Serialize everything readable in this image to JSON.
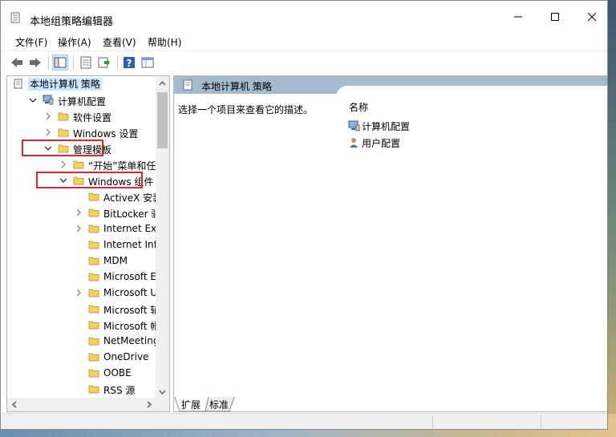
{
  "window": {
    "title": "本地组策略编辑器",
    "controls": [
      "minimize",
      "maximize",
      "close"
    ]
  },
  "menu": [
    "文件(F)",
    "操作(A)",
    "查看(V)",
    "帮助(H)"
  ],
  "toolbar": [
    "back-icon",
    "forward-icon",
    "show-hide-tree-icon",
    "properties-icon",
    "export-list-icon",
    "help-icon",
    "filter-icon"
  ],
  "tree": [
    {
      "label": "本地计算机 策略",
      "expander": "none",
      "icon": "policy-icon",
      "selected": true
    },
    {
      "label": "计算机配置",
      "expander": "expanded",
      "icon": "computer-icon"
    },
    {
      "label": "软件设置",
      "expander": "collapsed",
      "icon": "folder-icon"
    },
    {
      "label": "Windows 设置",
      "expander": "collapsed",
      "icon": "folder-icon"
    },
    {
      "label": "管理模板",
      "expander": "expanded",
      "icon": "folder-icon",
      "highlighted": true
    },
    {
      "label": "“开始”菜单和任务栏",
      "expander": "collapsed",
      "icon": "folder-icon"
    },
    {
      "label": "Windows 组件",
      "expander": "expanded",
      "icon": "folder-icon",
      "highlighted": true
    },
    {
      "label": "ActiveX 安装程",
      "expander": "none",
      "icon": "folder-icon"
    },
    {
      "label": "BitLocker 驱动",
      "expander": "collapsed",
      "icon": "folder-icon"
    },
    {
      "label": "Internet Explo",
      "expander": "collapsed",
      "icon": "folder-icon"
    },
    {
      "label": "Internet Inforr",
      "expander": "none",
      "icon": "folder-icon"
    },
    {
      "label": "MDM",
      "expander": "none",
      "icon": "folder-icon"
    },
    {
      "label": "Microsoft Edg",
      "expander": "none",
      "icon": "folder-icon"
    },
    {
      "label": "Microsoft Use",
      "expander": "collapsed",
      "icon": "folder-icon"
    },
    {
      "label": "Microsoft 辅助",
      "expander": "none",
      "icon": "folder-icon"
    },
    {
      "label": "Microsoft 帐户",
      "expander": "none",
      "icon": "folder-icon"
    },
    {
      "label": "NetMeeting",
      "expander": "none",
      "icon": "folder-icon"
    },
    {
      "label": "OneDrive",
      "expander": "none",
      "icon": "folder-icon"
    },
    {
      "label": "OOBE",
      "expander": "none",
      "icon": "folder-icon"
    },
    {
      "label": "RSS 源",
      "expander": "none",
      "icon": "folder-icon"
    }
  ],
  "detail": {
    "header": "本地计算机 策略",
    "description": "选择一个项目来查看它的描述。",
    "column_name": "名称",
    "items": [
      {
        "label": "计算机配置",
        "icon": "computer-icon"
      },
      {
        "label": "用户配置",
        "icon": "user-icon"
      }
    ]
  },
  "tabs": [
    "扩展",
    "标准"
  ],
  "colors": {
    "highlight": "#e5232b",
    "header": "#a4bacd",
    "selection": "#cce8ff",
    "folder": "#f3cf6a"
  }
}
